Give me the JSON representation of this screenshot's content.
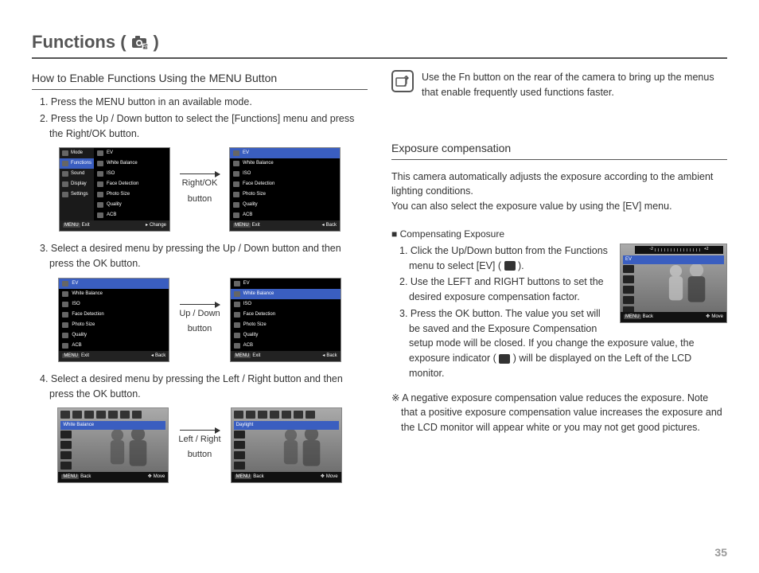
{
  "page": {
    "title_prefix": "Functions (",
    "title_suffix": ")",
    "number": "35"
  },
  "left": {
    "heading": "How to Enable Functions Using the MENU Button",
    "step1": "1. Press the MENU button in an available mode.",
    "step2": "2. Press the Up / Down button to select the [Functions] menu and press the Right/OK button.",
    "arrow1_label_a": "Right/OK",
    "arrow1_label_b": "button",
    "step3": "3. Select a desired menu by pressing the Up / Down button and then press the OK button.",
    "arrow2_label_a": "Up / Down",
    "arrow2_label_b": "button",
    "step4": "4. Select a desired menu by pressing the Left / Right button and then press the OK button.",
    "arrow3_label_a": "Left / Right",
    "arrow3_label_b": "button",
    "screen1": {
      "sidebar": [
        "Mode",
        "Functions",
        "Sound",
        "Display",
        "Settings"
      ],
      "sidebar_selected": "Functions",
      "list": [
        "EV",
        "White Balance",
        "ISO",
        "Face Detection",
        "Photo Size",
        "Quality",
        "ACB"
      ],
      "footer_left": "Exit",
      "footer_right": "Change"
    },
    "screen2": {
      "list": [
        "EV",
        "White Balance",
        "ISO",
        "Face Detection",
        "Photo Size",
        "Quality",
        "ACB"
      ],
      "selected": "EV",
      "footer_left": "Exit",
      "footer_right": "Back"
    },
    "screen3": {
      "list": [
        "EV",
        "White Balance",
        "ISO",
        "Face Detection",
        "Photo Size",
        "Quality",
        "ACB"
      ],
      "selected": "EV",
      "footer_left": "Exit",
      "footer_right": "Back"
    },
    "screen4": {
      "list": [
        "EV",
        "White Balance",
        "ISO",
        "Face Detection",
        "Photo Size",
        "Quality",
        "ACB"
      ],
      "selected": "White Balance",
      "footer_left": "Exit",
      "footer_right": "Back"
    },
    "photo1": {
      "selected_label": "White Balance",
      "footer_left": "Back",
      "footer_right": "Move"
    },
    "photo2": {
      "selected_label": "Daylight",
      "footer_left": "Back",
      "footer_right": "Move"
    }
  },
  "right": {
    "tip": "Use the Fn button on the rear of the camera to bring up the menus that enable frequently used functions faster.",
    "heading": "Exposure compensation",
    "p1": "This camera automatically adjusts the exposure according to the ambient lighting conditions.",
    "p2": "You can also select the exposure value by using the [EV] menu.",
    "sub": "Compensating Exposure",
    "s1a": "1. Click the Up/Down button from the Functions menu to select [EV] (",
    "s1b": ").",
    "s2": "2. Use the LEFT and RIGHT buttons to set the desired exposure compensation factor.",
    "s3a": "3. Press the OK button. The value you set will be saved and the Exposure Compensation setup mode will be closed. If you change the exposure value, the exposure indicator (",
    "s3b": ") will be displayed on the Left of the LCD monitor.",
    "note": "A negative exposure compensation value reduces the exposure. Note that a positive exposure compensation value increases the exposure and the LCD monitor will appear white or you may not get good pictures.",
    "ev_screen": {
      "selected_label": "EV",
      "footer_left": "Back",
      "footer_right": "Move"
    }
  }
}
